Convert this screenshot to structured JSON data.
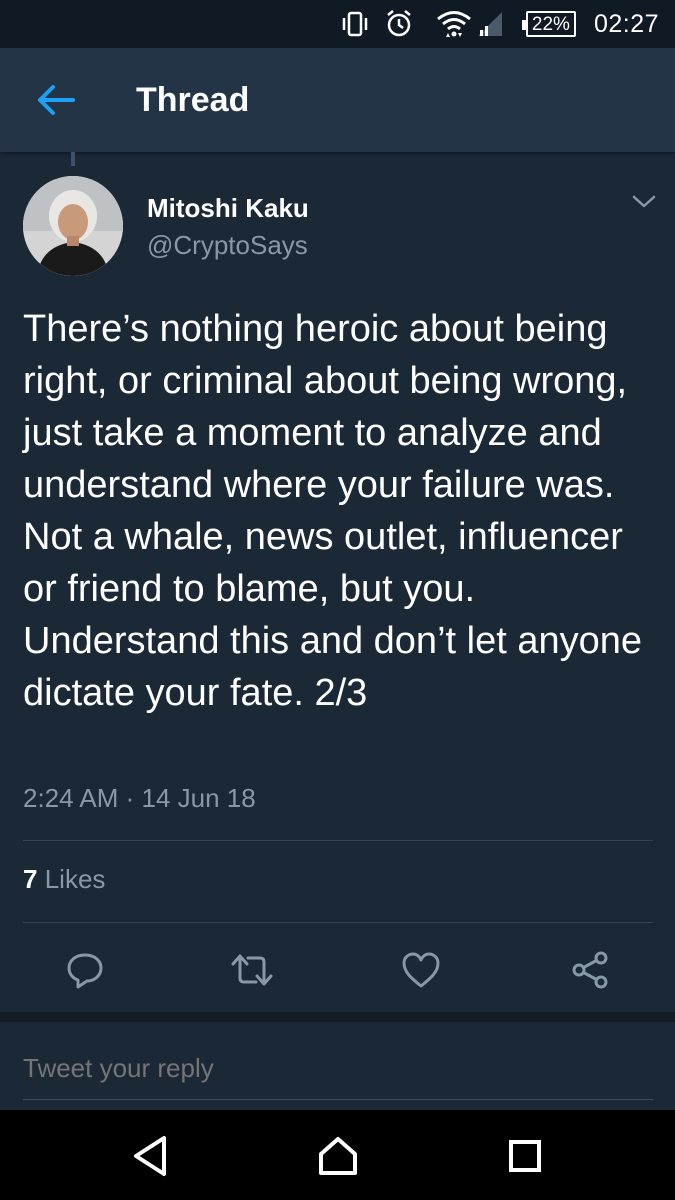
{
  "status_bar": {
    "battery": "22%",
    "time": "02:27",
    "icons": [
      "vibrate-icon",
      "alarm-icon",
      "wifi-icon",
      "signal-icon",
      "battery-icon"
    ]
  },
  "appbar": {
    "title": "Thread",
    "back_icon": "arrow-left-icon"
  },
  "tweet": {
    "author_name": "Mitoshi Kaku",
    "author_handle": "@CryptoSays",
    "text": "There’s nothing heroic about being right, or criminal about being wrong, just take a moment to analyze and understand where your failure was. Not a whale, news outlet, influencer or friend to blame, but you. Understand this and don’t let anyone dictate your fate. 2/3",
    "timestamp": "2:24 AM · 14 Jun 18",
    "likes_count": "7",
    "likes_label": "Likes"
  },
  "actions": [
    "reply-icon",
    "retweet-icon",
    "like-icon",
    "share-icon"
  ],
  "reply": {
    "placeholder": "Tweet your reply"
  },
  "colors": {
    "accent": "#1da1f2",
    "background": "#1b2836",
    "appbar": "#243447",
    "secondary_text": "#8899a6"
  },
  "navbar": [
    "back-nav-icon",
    "home-nav-icon",
    "recents-nav-icon"
  ]
}
